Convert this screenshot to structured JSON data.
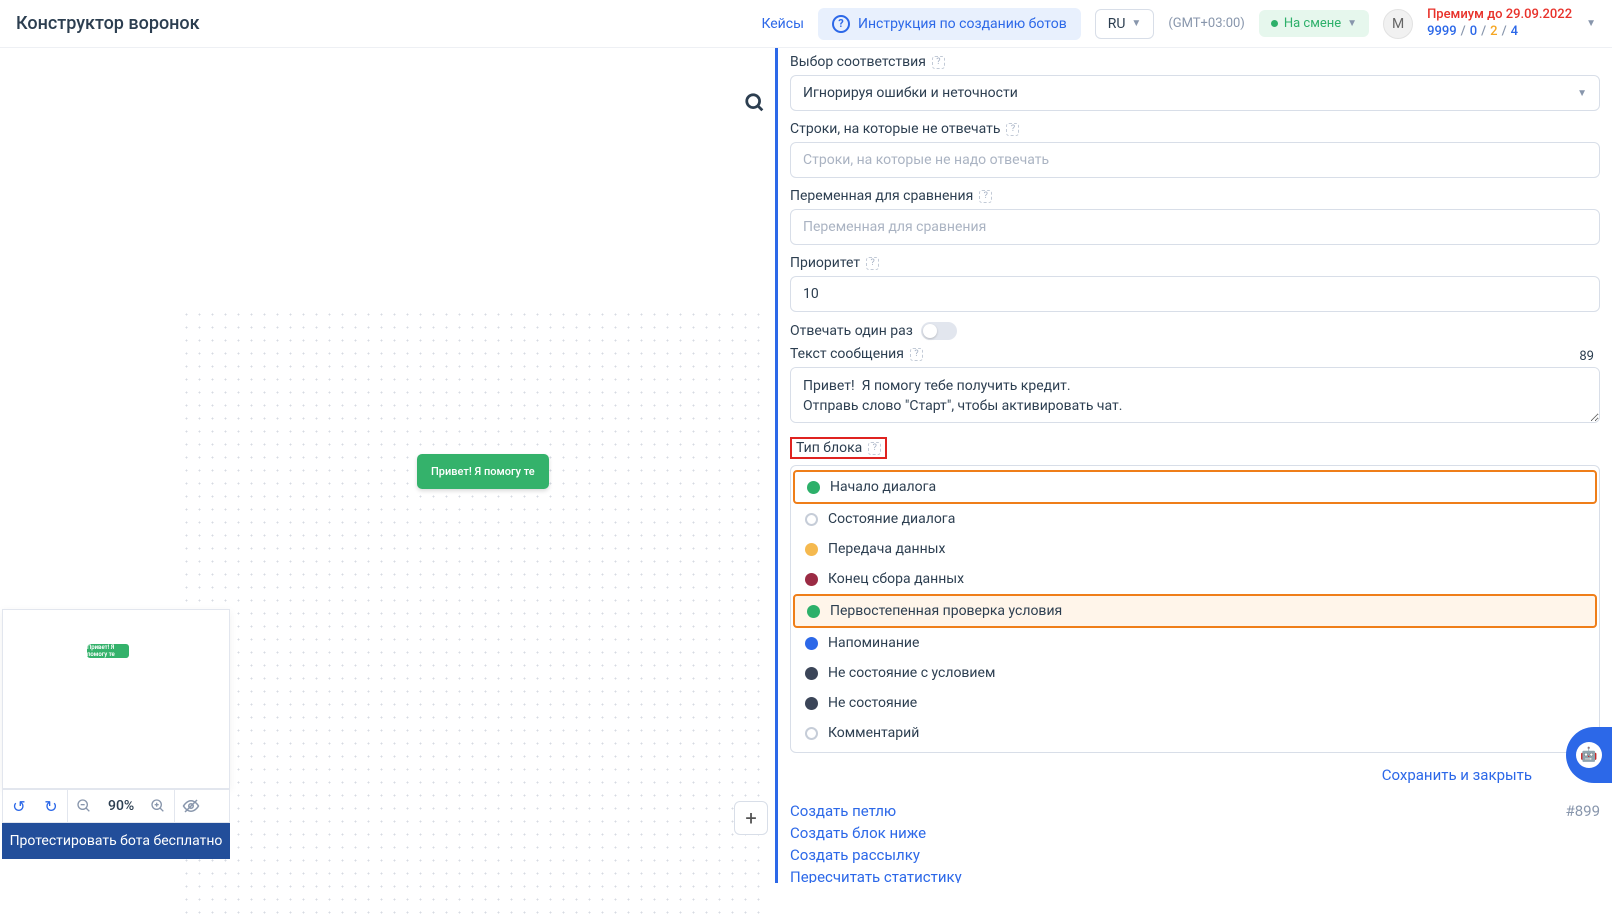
{
  "header": {
    "title": "Конструктор воронок",
    "cases_link": "Кейсы",
    "instruction_btn": "Инструкция по созданию ботов",
    "language": "RU",
    "timezone": "(GMT+03:00)",
    "status_label": "На смене",
    "avatar_letter": "М",
    "premium_until": "Премиум до 29.09.2022",
    "counters": {
      "a": "9999",
      "b": "0",
      "c": "2",
      "d": "4"
    }
  },
  "canvas": {
    "node_text": "Привет!  Я помогу те",
    "mini_node_text": "Привет!  Я помогу те",
    "zoom_level": "90%",
    "test_button": "Протестировать бота бесплатно"
  },
  "panel": {
    "match_label": "Выбор соответствия",
    "match_value": "Игнорируя ошибки и неточности",
    "ignore_lines_label": "Строки, на которые не отвечать",
    "ignore_lines_placeholder": "Строки, на которые не надо отвечать",
    "compare_var_label": "Переменная для сравнения",
    "compare_var_placeholder": "Переменная для сравнения",
    "priority_label": "Приоритет",
    "priority_value": "10",
    "answer_once_label": "Отвечать один раз",
    "message_text_label": "Текст сообщения",
    "message_char_count": "89",
    "message_text_value": "Привет!  Я помогу тебе получить кредит.\nОтправь слово \"Старт\", чтобы активировать чат.",
    "block_type_label": "Тип блока",
    "block_types": [
      {
        "label": "Начало диалога",
        "color": "#2db06a",
        "selected": true,
        "framed": true
      },
      {
        "label": "Состояние диалога",
        "color": "",
        "selected": false,
        "framed": false
      },
      {
        "label": "Передача данных",
        "color": "#f5b94f",
        "selected": false,
        "framed": false
      },
      {
        "label": "Конец сбора данных",
        "color": "#9b2b44",
        "selected": false,
        "framed": false
      },
      {
        "label": "Первостепенная проверка условия",
        "color": "#2db06a",
        "selected": false,
        "framed": true,
        "hover": true
      },
      {
        "label": "Напоминание",
        "color": "#2c68e8",
        "selected": false,
        "framed": false
      },
      {
        "label": "Не состояние с условием",
        "color": "#3b4558",
        "selected": false,
        "framed": false
      },
      {
        "label": "Не состояние",
        "color": "#3b4558",
        "selected": false,
        "framed": false
      },
      {
        "label": "Комментарий",
        "color": "",
        "selected": false,
        "framed": false
      }
    ],
    "save_close": "Сохранить и закрыть",
    "footer": {
      "create_loop": "Создать петлю",
      "record_id": "#899",
      "create_block_below": "Создать блок ниже",
      "create_mailing": "Создать рассылку",
      "recalc_stats": "Пересчитать статистику"
    }
  }
}
